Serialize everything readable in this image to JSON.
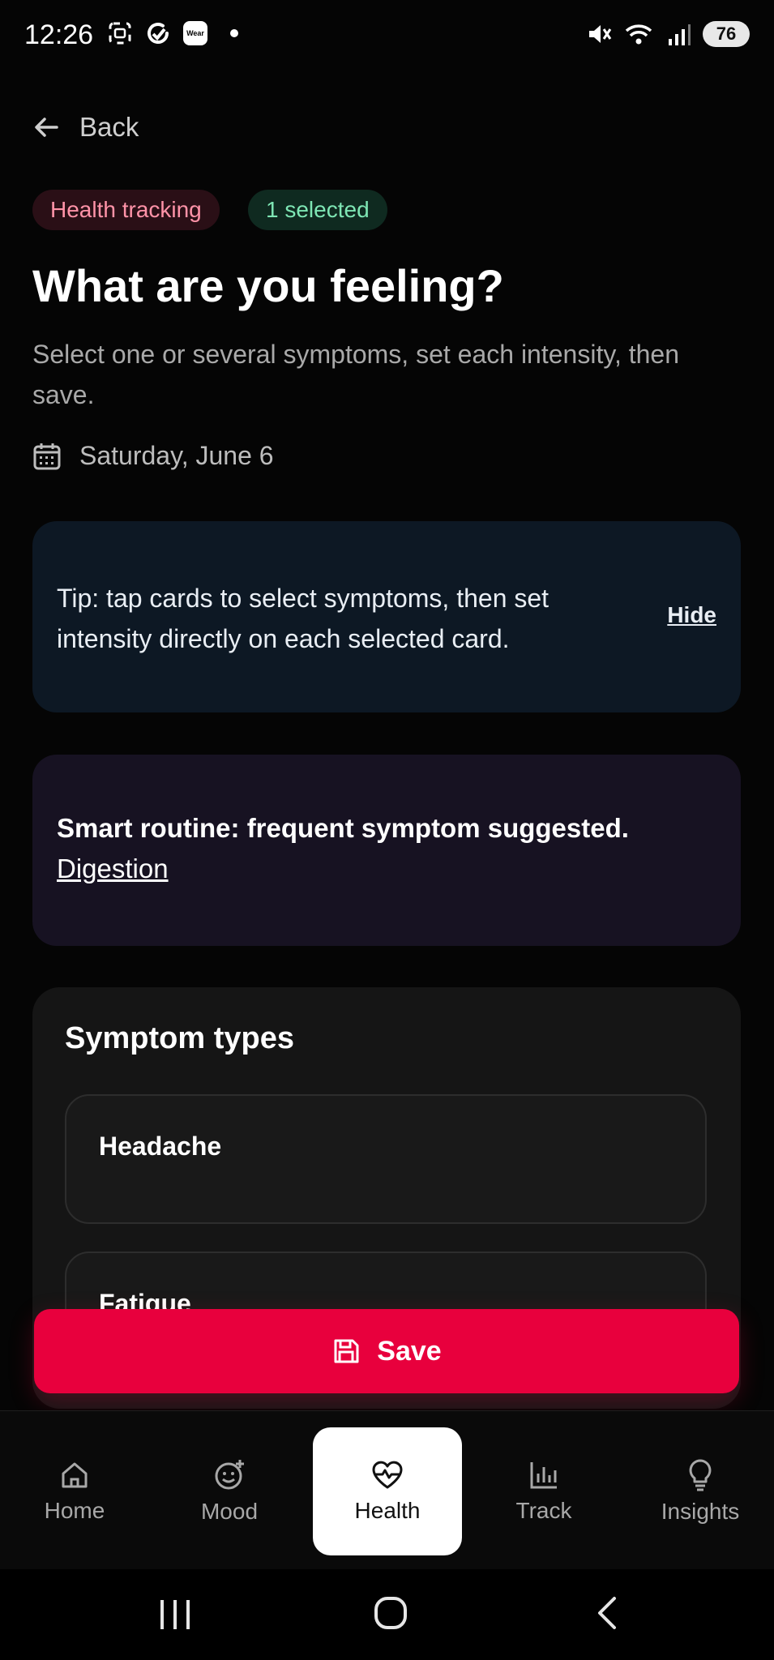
{
  "status": {
    "time": "12:26",
    "battery": "76",
    "wear_label": "Wear"
  },
  "back_label": "Back",
  "pills": {
    "category": "Health tracking",
    "selected": "1 selected"
  },
  "title": "What are you feeling?",
  "subtitle": "Select one or several symptoms, set each intensity, then save.",
  "date": "Saturday, June 6",
  "tip": {
    "text": "Tip: tap cards to select symptoms, then set intensity directly on each selected card.",
    "hide_label": "Hide"
  },
  "smart": {
    "text": "Smart routine: frequent symptom suggested.",
    "link": "Digestion"
  },
  "symptoms": {
    "heading": "Symptom types",
    "items": [
      "Headache",
      "Fatigue"
    ]
  },
  "save_label": "Save",
  "nav": [
    {
      "label": "Home",
      "icon": "home-icon"
    },
    {
      "label": "Mood",
      "icon": "mood-icon"
    },
    {
      "label": "Health",
      "icon": "heart-pulse-icon",
      "active": true
    },
    {
      "label": "Track",
      "icon": "bar-chart-icon"
    },
    {
      "label": "Insights",
      "icon": "lightbulb-icon"
    }
  ],
  "colors": {
    "accent": "#e8003d",
    "background": "#050505"
  }
}
